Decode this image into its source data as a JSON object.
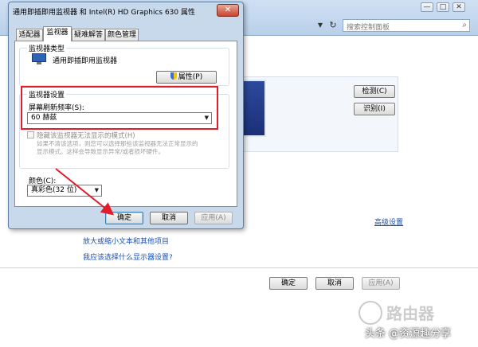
{
  "dialog": {
    "title": "通用即插即用监视器 和 Intel(R) HD Graphics 630 属性",
    "close_label": "✕",
    "tabs": [
      {
        "label": "适配器"
      },
      {
        "label": "监视器"
      },
      {
        "label": "疑难解答"
      },
      {
        "label": "颜色管理"
      }
    ],
    "monitor_type": {
      "group_label": "监视器类型",
      "name": "通用即插即用监视器",
      "properties_button": "属性(P)"
    },
    "monitor_settings": {
      "group_label": "监视器设置",
      "refresh_label": "屏幕刷新频率(S):",
      "refresh_value": "60 赫兹",
      "hide_modes_label": "隐藏该监视器无法显示的模式(H)",
      "hide_modes_desc_1": "如果不清该选项，则您可以选择那些该监视器无法正常显示的",
      "hide_modes_desc_2": "显示模式。这样会导致显示异常/或者损坏硬件。"
    },
    "color": {
      "label": "颜色(C):",
      "value": "真彩色(32 位)"
    },
    "buttons": {
      "ok": "确定",
      "cancel": "取消",
      "apply": "应用(A)"
    }
  },
  "background": {
    "caption": {
      "minimize": "—",
      "maximize": "□",
      "close": "✕"
    },
    "search_placeholder": "搜索控制面板",
    "detect_button": "检测(C)",
    "identify_button": "识别(I)",
    "advanced_link": "高级设置",
    "links": [
      "放大或缩小文本和其他项目",
      "我应该选择什么显示器设置?"
    ],
    "buttons": {
      "ok": "确定",
      "cancel": "取消",
      "apply": "应用(A)"
    }
  },
  "watermark": {
    "router": "路由器",
    "credit": "头条 @资源趣分享"
  },
  "colors": {
    "annotation_red": "#e21c2a",
    "dialog_frame": "#c9d9ec",
    "link_blue": "#1a4fb2"
  }
}
